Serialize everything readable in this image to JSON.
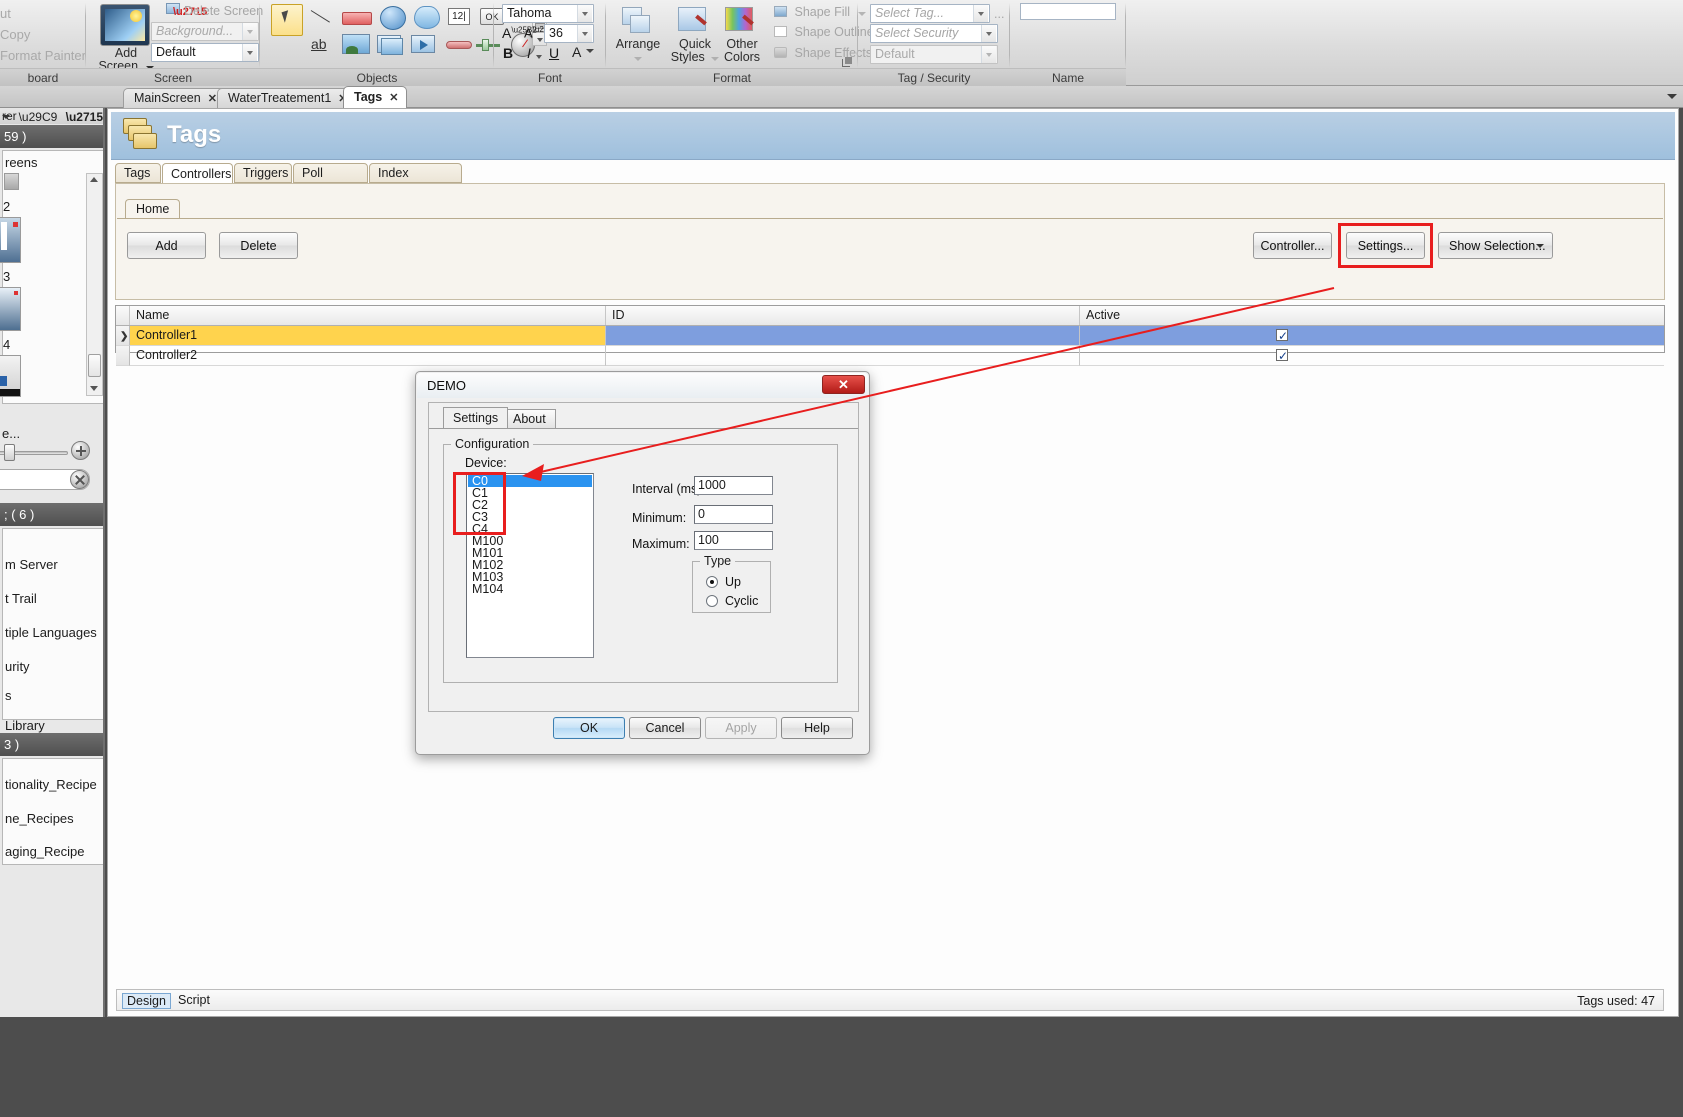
{
  "ribbon": {
    "groups": [
      {
        "label": "board",
        "name": "clipboard"
      },
      {
        "label": "Screen",
        "name": "screen"
      },
      {
        "label": "Objects",
        "name": "objects"
      },
      {
        "label": "Font",
        "name": "font"
      },
      {
        "label": "Format",
        "name": "format"
      },
      {
        "label": "Tag / Security",
        "name": "tag-security"
      },
      {
        "label": "Name",
        "name": "name"
      }
    ],
    "clipboard": {
      "cut": "ut",
      "copy": "Copy",
      "format_painter": "Format Painter"
    },
    "screen": {
      "add_screen": "Add",
      "add_screen_2": "Screen",
      "delete_screen": "Delete Screen",
      "background": "Background...",
      "style_value": "Default"
    },
    "font": {
      "font_name": "Tahoma",
      "font_size": "36",
      "bold": "B",
      "italic": "I",
      "underline": "U",
      "grow": "A",
      "shrink": "A",
      "color": "A"
    },
    "format": {
      "arrange": "Arrange",
      "quick_styles_1": "Quick",
      "quick_styles_2": "Styles",
      "other_colors_1": "Other",
      "other_colors_2": "Colors",
      "shape_fill": "Shape Fill",
      "shape_outline": "Shape Outline",
      "shape_effects": "Shape Effects"
    },
    "tag_security": {
      "select_tag": "Select Tag...",
      "ellipsis": "...",
      "select_security_groups": "Select Security Groups...",
      "default": "Default"
    },
    "name": {
      "value": ""
    }
  },
  "doctabs": [
    {
      "label": "MainScreen",
      "close": "✕",
      "active": false
    },
    {
      "label": "WaterTreatement1",
      "close": "✕",
      "active": false
    },
    {
      "label": "Tags",
      "close": "✕",
      "active": true
    }
  ],
  "leftdock": {
    "header": {
      "title": "rer",
      "dropdown_icon": "chevron-down",
      "pin_icon": "pin",
      "close_icon": "close"
    },
    "sections": [
      {
        "label": "59 )"
      },
      {
        "label": "; ( 6 )"
      },
      {
        "label": "3 )"
      }
    ],
    "screens_label": "reens",
    "screen_items": [
      "2",
      "3",
      "4"
    ],
    "more_label": "e...",
    "system_items": [
      "m Server",
      "t Trail",
      "tiple Languages",
      "urity",
      "s",
      " Library"
    ],
    "recipe_items": [
      "tionality_Recipe",
      "ne_Recipes",
      "aging_Recipe"
    ]
  },
  "page": {
    "title": "Tags",
    "subtabs": [
      {
        "label": "Tags",
        "active": false
      },
      {
        "label": "Controllers",
        "active": true
      },
      {
        "label": "Triggers",
        "active": false
      },
      {
        "label": "Poll Groups",
        "active": false
      },
      {
        "label": "Index Registers",
        "active": false
      }
    ],
    "home_tab": "Home",
    "buttons": {
      "add": "Add",
      "delete": "Delete",
      "controller": "Controller...",
      "settings": "Settings...",
      "show_selection": "Show Selection..."
    },
    "grid": {
      "columns": [
        "Name",
        "ID",
        "Active"
      ],
      "rows": [
        {
          "marker": "❯",
          "name": "Controller1",
          "id": "",
          "active": true,
          "selected": true
        },
        {
          "marker": "",
          "name": "Controller2",
          "id": "",
          "active": true,
          "selected": false
        }
      ]
    },
    "footer": {
      "design": "Design",
      "script": "Script",
      "tags_used": "Tags used: 47"
    }
  },
  "dialog": {
    "title": "DEMO",
    "close_label": "✕",
    "tabs": [
      {
        "label": "Settings",
        "active": true
      },
      {
        "label": "About",
        "active": false
      }
    ],
    "group_title": "Configuration",
    "device_label": "Device:",
    "devices": [
      "C0",
      "C1",
      "C2",
      "C3",
      "C4",
      "M100",
      "M101",
      "M102",
      "M103",
      "M104"
    ],
    "selected_device": "C0",
    "fields": [
      {
        "label": "Interval (ms):",
        "value": "1000"
      },
      {
        "label": "Minimum:",
        "value": "0"
      },
      {
        "label": "Maximum:",
        "value": "100"
      }
    ],
    "type_group": "Type",
    "type_options": [
      {
        "label": "Up",
        "checked": true
      },
      {
        "label": "Cyclic",
        "checked": false
      }
    ],
    "buttons": {
      "ok": "OK",
      "cancel": "Cancel",
      "apply": "Apply",
      "help": "Help"
    }
  },
  "colors": {
    "accent_blue": "#2a93f0",
    "row_selected_yellow": "#ffd34d",
    "row_selected_blue": "#7e9ede",
    "annotation_red": "#e81e1e",
    "header_blue": "#9fc0dd"
  }
}
